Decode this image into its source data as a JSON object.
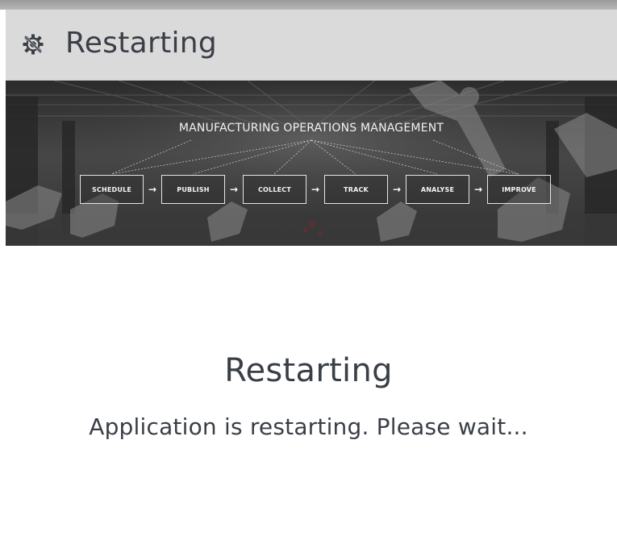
{
  "header": {
    "icon": "gear-restart-icon",
    "title": "Restarting"
  },
  "banner": {
    "heading": "MANUFACTURING OPERATIONS MANAGEMENT",
    "steps": [
      "SCHEDULE",
      "PUBLISH",
      "COLLECT",
      "TRACK",
      "ANALYSE",
      "IMPROVE"
    ],
    "arrow_glyph": "→"
  },
  "main": {
    "title": "Restarting",
    "message": "Application is restarting. Please wait..."
  },
  "colors": {
    "title_bar_bg": "#dadada",
    "text": "#3a3f47",
    "banner_bg": "#3c3c3c"
  }
}
